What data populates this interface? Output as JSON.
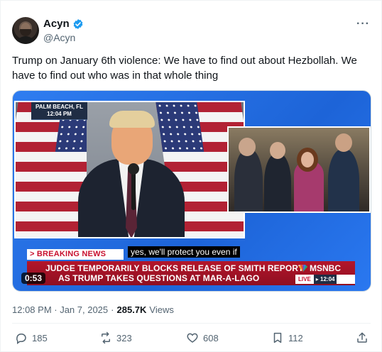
{
  "author": {
    "display_name": "Acyn",
    "handle": "@Acyn"
  },
  "tweet": {
    "text": "Trump on January 6th violence: We have to find out about Hezbollah. We have to find out who was in that whole thing",
    "timestamp": "12:08 PM · Jan 7, 2025",
    "views_count": "285.7K",
    "views_label": "Views"
  },
  "media": {
    "location_line1": "PALM BEACH, FL",
    "location_line2": "12:04 PM",
    "breaking_label": "> BREAKING NEWS",
    "caption": "yes, we'll protect you even if",
    "chyron_line1": "JUDGE TEMPORARILY BLOCKS RELEASE OF SMITH REPORT",
    "chyron_line2": "AS TRUMP TAKES QUESTIONS AT MAR-A-LAGO",
    "network": "MSNBC",
    "live_label": "LIVE",
    "live_time": "▸ 12:04",
    "duration": "0:53"
  },
  "actions": {
    "replies": "185",
    "reposts": "323",
    "likes": "608",
    "bookmarks": "112"
  },
  "colors": {
    "accent_blue": "#1d9bf0",
    "text_primary": "#0f1419",
    "text_secondary": "#536471",
    "chyron_red": "#b3162b"
  },
  "icons": [
    "avatar",
    "verified-badge-icon",
    "more-icon",
    "reply-icon",
    "repost-icon",
    "like-icon",
    "bookmark-icon",
    "share-icon"
  ]
}
